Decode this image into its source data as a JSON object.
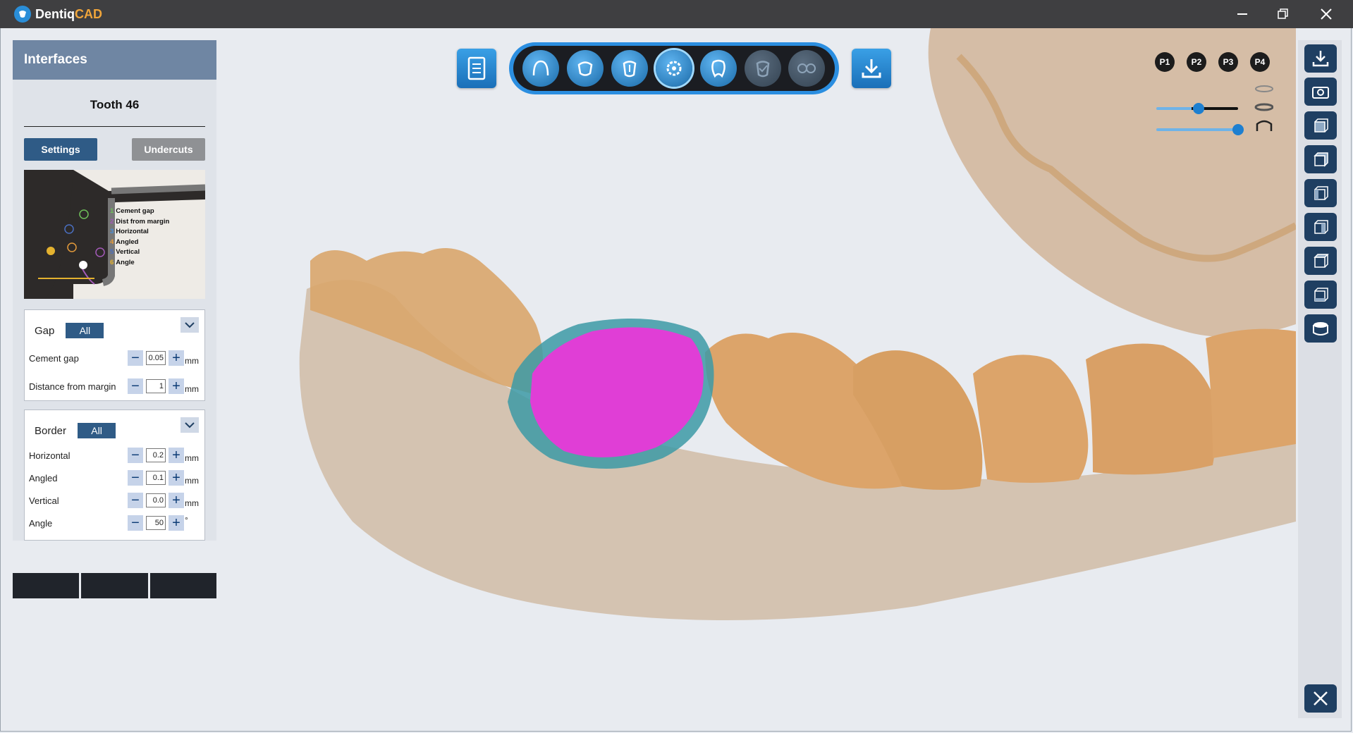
{
  "window": {
    "app_name_prefix": "Dentiq",
    "app_name_suffix": "CAD"
  },
  "panel": {
    "header": "Interfaces",
    "tooth_title": "Tooth 46",
    "tabs": {
      "settings": "Settings",
      "undercuts": "Undercuts"
    },
    "diagram_legend": [
      {
        "num": "1",
        "label": "Cement gap",
        "color": "#6fbf5a"
      },
      {
        "num": "2",
        "label": "Dist from margin",
        "color": "#a35ab8"
      },
      {
        "num": "3",
        "label": "Horizontal",
        "color": "#4b8fd8"
      },
      {
        "num": "4",
        "label": "Angled",
        "color": "#e39a3a"
      },
      {
        "num": "5",
        "label": "Vertical",
        "color": "#4a6fc0"
      },
      {
        "num": "6",
        "label": "Angle",
        "color": "#e4b22f"
      }
    ],
    "gap": {
      "label": "Gap",
      "all_label": "All",
      "rows": [
        {
          "label": "Cement gap",
          "value": "0.05",
          "unit": "mm"
        },
        {
          "label": "Distance from margin",
          "value": "1",
          "unit": "mm"
        }
      ]
    },
    "border": {
      "label": "Border",
      "all_label": "All",
      "rows": [
        {
          "label": "Horizontal",
          "value": "0.2",
          "unit": "mm"
        },
        {
          "label": "Angled",
          "value": "0.1",
          "unit": "mm"
        },
        {
          "label": "Vertical",
          "value": "0.0",
          "unit": "mm"
        },
        {
          "label": "Angle",
          "value": "50",
          "unit": "°"
        }
      ]
    }
  },
  "view_tags": [
    "P1",
    "P2",
    "P3",
    "P4"
  ],
  "colors": {
    "accent": "#2b8ee0",
    "crown": "#e03ed6",
    "model": "#d9a66c"
  }
}
